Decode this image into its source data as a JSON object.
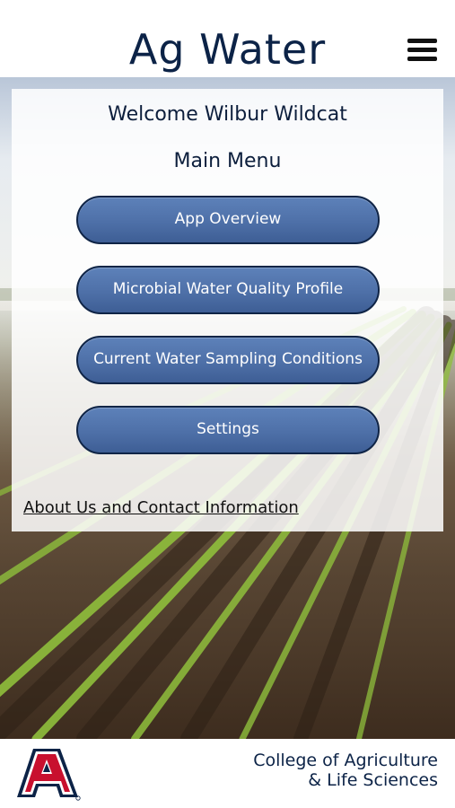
{
  "header": {
    "title": "Ag Water",
    "menu_icon": "hamburger-menu-icon"
  },
  "panel": {
    "welcome": "Welcome Wilbur Wildcat",
    "menu_title": "Main Menu",
    "buttons": [
      {
        "label": "App Overview"
      },
      {
        "label": "Microbial Water Quality Profile"
      },
      {
        "label": "Current Water Sampling Conditions"
      },
      {
        "label": "Settings"
      }
    ],
    "about_link": "About Us and Contact Information"
  },
  "footer": {
    "logo": "university-a-logo",
    "college_line1": "College of Agriculture",
    "college_line2": "& Life Sciences"
  },
  "colors": {
    "title_navy": "#0c2347",
    "button_blue": "#4e70a8",
    "button_border": "#0f2446",
    "battery_green": "#3ecb5a",
    "logo_red": "#c8102e"
  }
}
